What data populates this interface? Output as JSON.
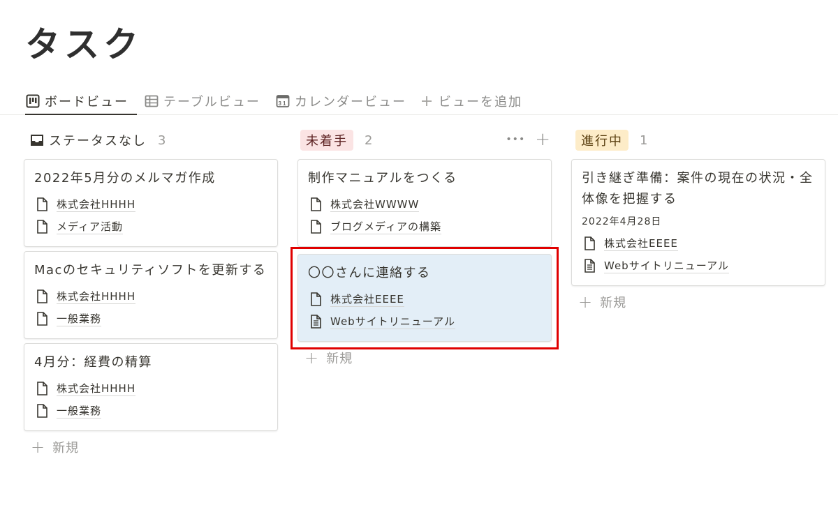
{
  "page": {
    "title": "タスク"
  },
  "tabs": [
    {
      "label": "ボードビュー",
      "icon": "board-icon"
    },
    {
      "label": "テーブルビュー",
      "icon": "table-icon"
    },
    {
      "label": "カレンダービュー",
      "icon": "calendar-icon",
      "icon_text": "31"
    },
    {
      "label": "ビューを追加",
      "icon": "plus-icon"
    }
  ],
  "columns": [
    {
      "name": "ステータスなし",
      "count": "3",
      "cards": [
        {
          "title": "2022年5月分のメルマガ作成",
          "relations": [
            "株式会社HHHH",
            "メディア活動"
          ]
        },
        {
          "title": "Macのセキュリティソフトを更新する",
          "relations": [
            "株式会社HHHH",
            "一般業務"
          ]
        },
        {
          "title": "4月分：経費の精算",
          "relations": [
            "株式会社HHHH",
            "一般業務"
          ]
        }
      ],
      "new_label": "新規"
    },
    {
      "name": "未着手",
      "count": "2",
      "color": "#fbe4e4",
      "more": "•••",
      "add": "+",
      "cards": [
        {
          "title": "制作マニュアルをつくる",
          "relations": [
            "株式会社WWWW",
            "ブログメディアの構築"
          ]
        },
        {
          "title": "〇〇さんに連絡する",
          "relations": [
            "株式会社EEEE",
            "Webサイトリニューアル"
          ]
        }
      ],
      "new_label": "新規"
    },
    {
      "name": "進行中",
      "count": "1",
      "color": "#fdecc8",
      "cards": [
        {
          "title": "引き継ぎ準備：案件の現在の状況・全体像を把握する",
          "date": "2022年4月28日",
          "relations": [
            "株式会社EEEE",
            "Webサイトリニューアル"
          ]
        }
      ],
      "new_label": "新規"
    }
  ],
  "highlight_color": "#e00000"
}
